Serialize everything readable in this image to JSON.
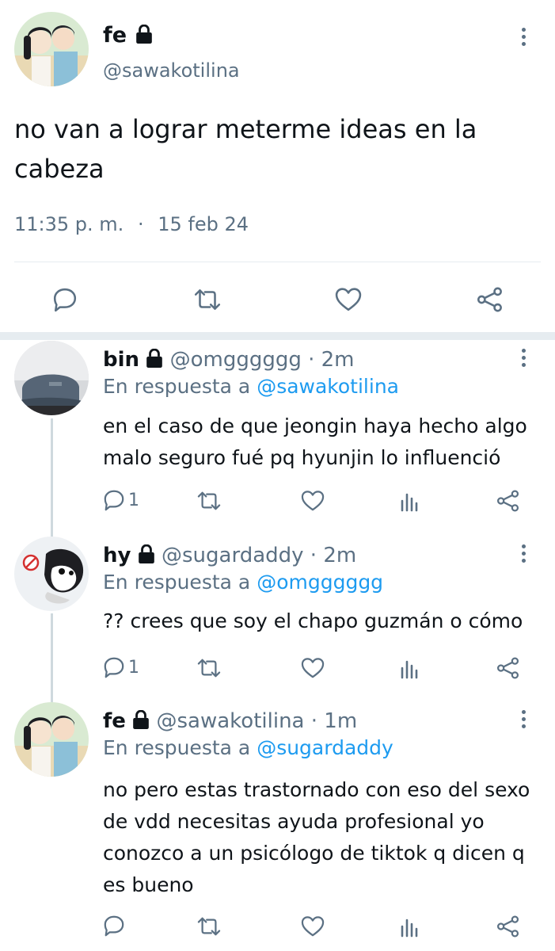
{
  "main_tweet": {
    "name": "fe",
    "handle": "@sawakotilina",
    "text_line1": "no van a lograr meterme ideas en la",
    "text_line2": "cabeza",
    "time": "11:35 p. m.",
    "dot": "·",
    "date": "15 feb 24"
  },
  "replies": [
    {
      "name": "bin",
      "handle": "@omgggggg",
      "sep": "·",
      "time": "2m",
      "reply_to_prefix": "En respuesta a",
      "reply_to": "@sawakotilina",
      "lines": [
        "en el caso de que jeongin haya hecho algo",
        "malo seguro fué pq hyunjin lo influenció"
      ],
      "reply_count": "1"
    },
    {
      "name": "hy",
      "handle": "@sugardaddy",
      "sep": "·",
      "time": "2m",
      "reply_to_prefix": "En respuesta a",
      "reply_to": "@omgggggg",
      "lines": [
        "?? crees que soy el chapo guzmán o cómo"
      ],
      "reply_count": "1"
    },
    {
      "name": "fe",
      "handle": "@sawakotilina",
      "sep": "·",
      "time": "1m",
      "reply_to_prefix": "En respuesta a",
      "reply_to": "@sugardaddy",
      "lines": [
        "no pero estas trastornado con eso del sexo",
        "de vdd necesitas ayuda profesional yo",
        "conozco a un psicólogo de tiktok q dicen q",
        "es bueno"
      ],
      "reply_count": ""
    }
  ],
  "colors": {
    "text": "#0f1419",
    "secondary": "#5b7083",
    "link": "#1d9bf0",
    "divider": "#e6ecf0"
  },
  "icons": [
    "reply-icon",
    "retweet-icon",
    "like-icon",
    "share-icon",
    "analytics-icon",
    "lock-icon",
    "more-icon"
  ]
}
